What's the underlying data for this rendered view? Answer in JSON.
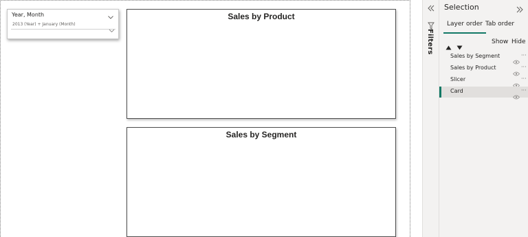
{
  "slicer": {
    "title": "Year, Month",
    "value": "2013 (Year) + January (Month)"
  },
  "visuals": [
    {
      "title": "Sales by Product"
    },
    {
      "title": "Sales by Segment"
    }
  ],
  "filters_pane": {
    "label": "Filters",
    "expand_icon": "double-chevron-left-icon",
    "filter_icon": "funnel-icon"
  },
  "selection_pane": {
    "title": "Selection",
    "tabs": [
      {
        "label": "Layer order",
        "active": true
      },
      {
        "label": "Tab order",
        "active": false
      }
    ],
    "show_label": "Show",
    "hide_label": "Hide",
    "items": [
      {
        "label": "Sales by Segment",
        "selected": false
      },
      {
        "label": "Sales by Product",
        "selected": false
      },
      {
        "label": "Slicer",
        "selected": false
      },
      {
        "label": "Card",
        "selected": true
      }
    ],
    "accent_color": "#117865"
  }
}
